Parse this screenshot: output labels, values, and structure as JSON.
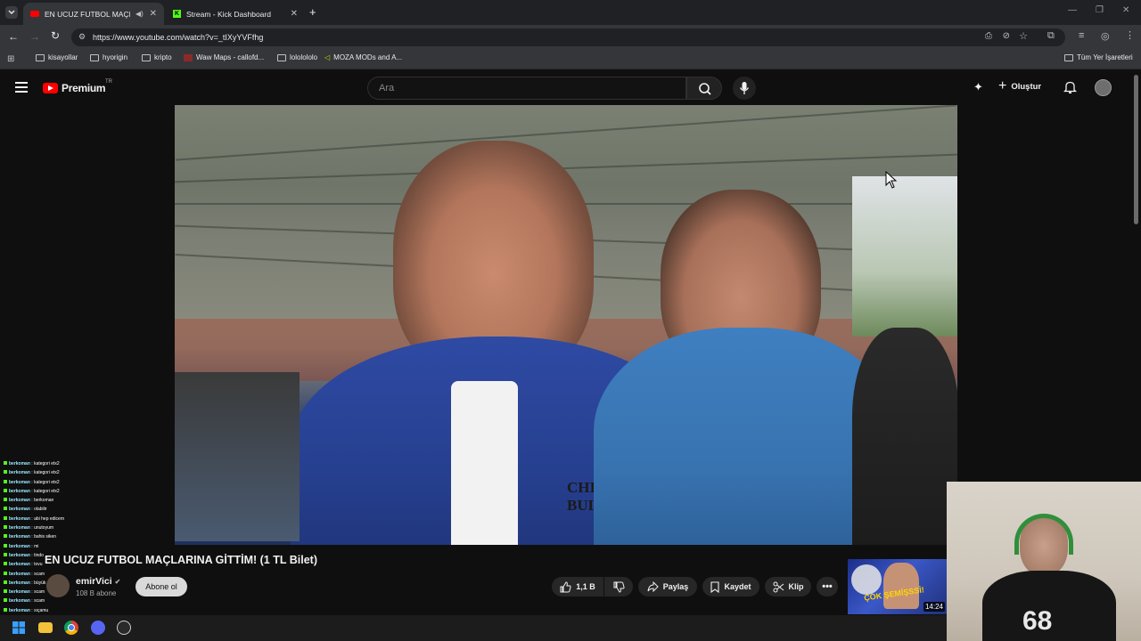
{
  "browser": {
    "tabs": [
      {
        "title": "EN UCUZ FUTBOL MAÇLAR",
        "active": true
      },
      {
        "title": "Stream - Kick Dashboard",
        "active": false
      }
    ],
    "url": "https://www.youtube.com/watch?v=_tIXyYVFfhg",
    "bookmarks": [
      "kisayollar",
      "hyorigin",
      "kripto",
      "Waw Maps - callofd...",
      "lololololo",
      "MOZA MODs and A..."
    ],
    "all_bookmarks_label": "Tüm Yer İşaretleri"
  },
  "youtube": {
    "logo_text": "Premium",
    "logo_region": "TR",
    "search_placeholder": "Ara",
    "create_label": "Oluştur",
    "video_title": "EN UCUZ FUTBOL MAÇLARINA GİTTİM! (1 TL Bilet)",
    "channel_name": "emirVici",
    "subscribers": "108 B abone",
    "subscribe_label": "Abone ol",
    "like_count": "1,1 B",
    "share_label": "Paylaş",
    "save_label": "Kaydet",
    "clip_label": "Klip",
    "thumb_duration": "14:24",
    "thumb_text": "ÇOK ŞEMİŞSSİ!"
  },
  "chat": [
    {
      "user": "berkoman",
      "msg": "kategori etx2"
    },
    {
      "user": "berkoman",
      "msg": "kategori etx2"
    },
    {
      "user": "berkoman",
      "msg": "kategori etx2"
    },
    {
      "user": "berkoman",
      "msg": "kategori etx2"
    },
    {
      "user": "berkoman",
      "msg": "berkoman"
    },
    {
      "user": "berkoman",
      "msg": "olabilir"
    },
    {
      "user": "berkoman",
      "msg": "abi hep edicem"
    },
    {
      "user": "berkoman",
      "msg": "unutoyum"
    },
    {
      "user": "berkoman",
      "msg": "bahis siken"
    },
    {
      "user": "berkoman",
      "msg": "mi"
    },
    {
      "user": "berkoman",
      "msg": "tindo"
    },
    {
      "user": "berkoman",
      "msg": "tovu"
    },
    {
      "user": "berkoman",
      "msg": "scam"
    },
    {
      "user": "berkoman",
      "msg": "büyük"
    },
    {
      "user": "berkoman",
      "msg": "scam"
    },
    {
      "user": "berkoman",
      "msg": "scam"
    },
    {
      "user": "berkoman",
      "msg": "sıçamu"
    }
  ],
  "colors": {
    "youtube_red": "#ff0000",
    "background": "#0f0f0f",
    "chrome_bg": "#35363a",
    "kick_green": "#53fc18"
  }
}
